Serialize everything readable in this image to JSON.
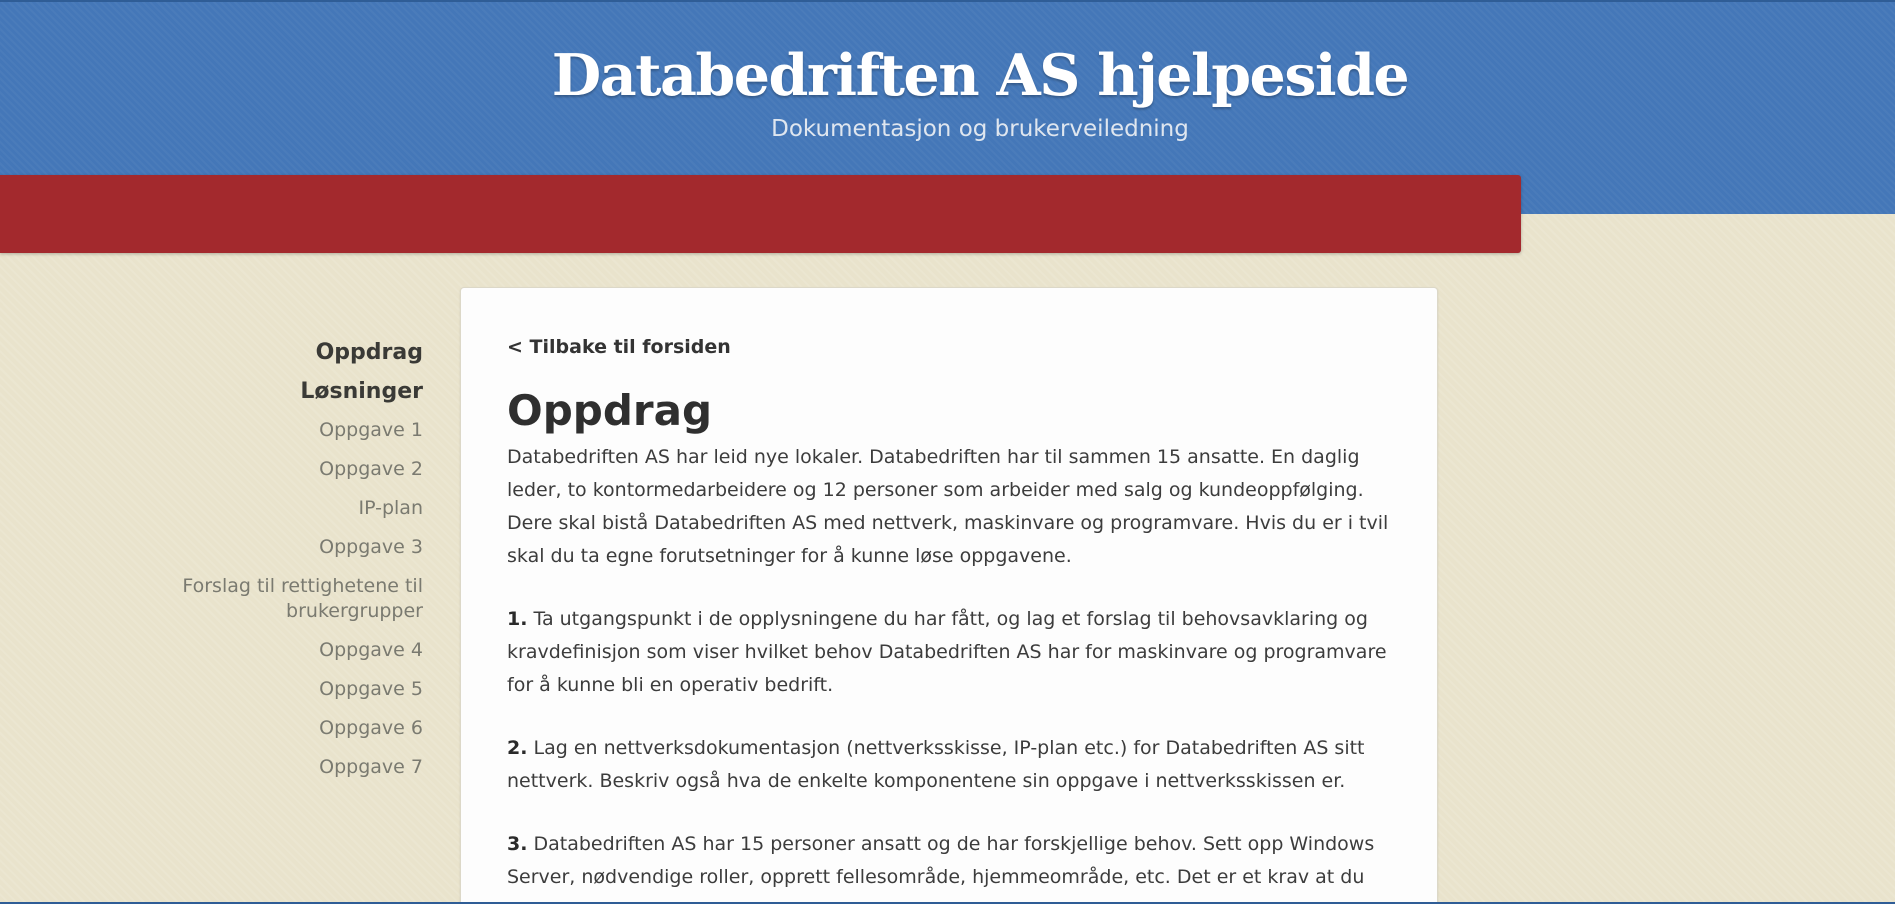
{
  "header": {
    "title": "Databedriften AS hjelpeside",
    "subtitle": "Dokumentasjon og brukerveiledning"
  },
  "colors": {
    "header_blue": "#4477b8",
    "nav_red": "#a3292d",
    "page_background": "#e9e3cc",
    "content_background": "#fdfdfd"
  },
  "sidebar": {
    "items": [
      {
        "label": "Oppdrag"
      },
      {
        "label": "Løsninger"
      },
      {
        "label": "Oppgave 1"
      },
      {
        "label": "Oppgave 2"
      },
      {
        "label": "IP-plan"
      },
      {
        "label": "Oppgave 3"
      },
      {
        "label": "Forslag til rettighetene til brukergrupper"
      },
      {
        "label": "Oppgave 4"
      },
      {
        "label": "Oppgave 5"
      },
      {
        "label": "Oppgave 6"
      },
      {
        "label": "Oppgave 7"
      }
    ]
  },
  "main": {
    "back_link": "< Tilbake til forsiden",
    "heading": "Oppdrag",
    "intro": "Databedriften AS har leid nye lokaler. Databedriften har til sammen 15 ansatte. En daglig leder, to kontormedarbeidere og 12 personer som arbeider med salg og kundeoppfølging. Dere skal bistå Databedriften AS med nettverk, maskinvare og programvare. Hvis du er i tvil skal du ta egne forutsetninger for å kunne løse oppgavene.",
    "tasks": [
      {
        "number": "1.",
        "text": "Ta utgangspunkt i de opplysningene du har fått, og lag et forslag til behovsavklaring og kravdefinisjon som viser hvilket behov Databedriften AS har for maskinvare og programvare for å kunne bli en operativ bedrift."
      },
      {
        "number": "2.",
        "text": "Lag en nettverksdokumentasjon (nettverksskisse, IP-plan etc.) for Databedriften AS sitt nettverk. Beskriv også hva de enkelte komponentene sin oppgave i nettverksskissen er."
      },
      {
        "number": "3.",
        "text": "Databedriften AS har 15 personer ansatt og de har forskjellige behov. Sett opp Windows Server, nødvendige roller, opprett fellesområde, hjemmeområde, etc. Det er et krav at du legger ved"
      }
    ]
  }
}
